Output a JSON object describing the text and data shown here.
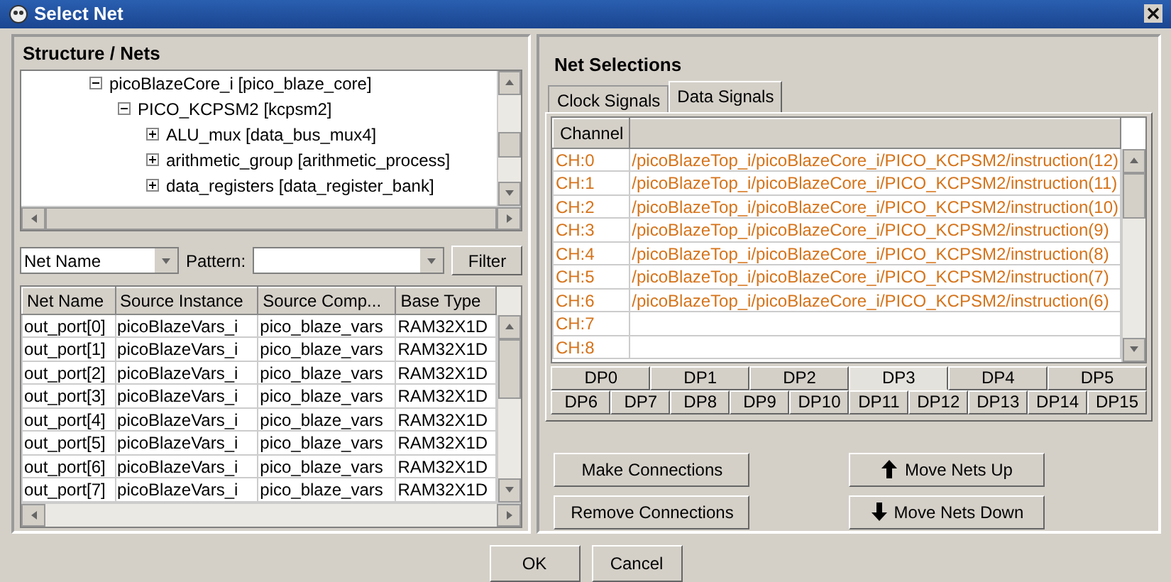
{
  "window": {
    "title": "Select Net"
  },
  "structure": {
    "title": "Structure / Nets",
    "tree": [
      {
        "label": "picoBlazeCore_i [pico_blaze_core]",
        "expanded": true,
        "children": [
          {
            "label": "PICO_KCPSM2 [kcpsm2]",
            "expanded": true,
            "children": [
              {
                "label": "ALU_mux [data_bus_mux4]",
                "expanded": false
              },
              {
                "label": "arithmetic_group [arithmetic_process]",
                "expanded": false
              },
              {
                "label": "data_registers [data_register_bank]",
                "expanded": false
              }
            ]
          }
        ]
      }
    ]
  },
  "filter": {
    "field": "Net Name",
    "pattern_label": "Pattern:",
    "button": "Filter"
  },
  "nets_table": {
    "columns": [
      "Net Name",
      "Source Instance",
      "Source Comp...",
      "Base Type"
    ],
    "rows": [
      [
        "out_port[0]",
        "picoBlazeVars_i",
        "pico_blaze_vars",
        "RAM32X1D"
      ],
      [
        "out_port[1]",
        "picoBlazeVars_i",
        "pico_blaze_vars",
        "RAM32X1D"
      ],
      [
        "out_port[2]",
        "picoBlazeVars_i",
        "pico_blaze_vars",
        "RAM32X1D"
      ],
      [
        "out_port[3]",
        "picoBlazeVars_i",
        "pico_blaze_vars",
        "RAM32X1D"
      ],
      [
        "out_port[4]",
        "picoBlazeVars_i",
        "pico_blaze_vars",
        "RAM32X1D"
      ],
      [
        "out_port[5]",
        "picoBlazeVars_i",
        "pico_blaze_vars",
        "RAM32X1D"
      ],
      [
        "out_port[6]",
        "picoBlazeVars_i",
        "pico_blaze_vars",
        "RAM32X1D"
      ],
      [
        "out_port[7]",
        "picoBlazeVars_i",
        "pico_blaze_vars",
        "RAM32X1D"
      ]
    ]
  },
  "selections": {
    "title": "Net Selections",
    "tabs": [
      {
        "label": "Clock Signals",
        "selected": false
      },
      {
        "label": "Data Signals",
        "selected": true
      }
    ],
    "channel_column": "Channel",
    "rows": [
      {
        "channel": "CH:0",
        "net": "/picoBlazeTop_i/picoBlazeCore_i/PICO_KCPSM2/instruction(12)"
      },
      {
        "channel": "CH:1",
        "net": "/picoBlazeTop_i/picoBlazeCore_i/PICO_KCPSM2/instruction(11)"
      },
      {
        "channel": "CH:2",
        "net": "/picoBlazeTop_i/picoBlazeCore_i/PICO_KCPSM2/instruction(10)"
      },
      {
        "channel": "CH:3",
        "net": "/picoBlazeTop_i/picoBlazeCore_i/PICO_KCPSM2/instruction(9)"
      },
      {
        "channel": "CH:4",
        "net": "/picoBlazeTop_i/picoBlazeCore_i/PICO_KCPSM2/instruction(8)"
      },
      {
        "channel": "CH:5",
        "net": "/picoBlazeTop_i/picoBlazeCore_i/PICO_KCPSM2/instruction(7)"
      },
      {
        "channel": "CH:6",
        "net": "/picoBlazeTop_i/picoBlazeCore_i/PICO_KCPSM2/instruction(6)"
      },
      {
        "channel": "CH:7",
        "net": null
      },
      {
        "channel": "CH:8",
        "net": null
      }
    ],
    "port_tab_rows": [
      {
        "tabs": [
          {
            "label": "DP0",
            "selected": false
          },
          {
            "label": "DP1",
            "selected": false
          },
          {
            "label": "DP2",
            "selected": false
          },
          {
            "label": "DP3",
            "selected": true
          },
          {
            "label": "DP4",
            "selected": false
          },
          {
            "label": "DP5",
            "selected": false
          }
        ]
      },
      {
        "tabs": [
          {
            "label": "DP6",
            "selected": false
          },
          {
            "label": "DP7",
            "selected": false
          },
          {
            "label": "DP8",
            "selected": false
          },
          {
            "label": "DP9",
            "selected": false
          },
          {
            "label": "DP10",
            "selected": false
          },
          {
            "label": "DP11",
            "selected": false
          },
          {
            "label": "DP12",
            "selected": false
          },
          {
            "label": "DP13",
            "selected": false
          },
          {
            "label": "DP14",
            "selected": false
          },
          {
            "label": "DP15",
            "selected": false
          }
        ]
      }
    ],
    "buttons": [
      {
        "label": "Make Connections",
        "kind": "plain"
      },
      {
        "label": "Move Nets Up",
        "kind": "up"
      },
      {
        "label": "Remove Connections",
        "kind": "plain"
      },
      {
        "label": "Move Nets Down",
        "kind": "down"
      }
    ]
  },
  "footer_buttons": [
    "OK",
    "Cancel"
  ]
}
